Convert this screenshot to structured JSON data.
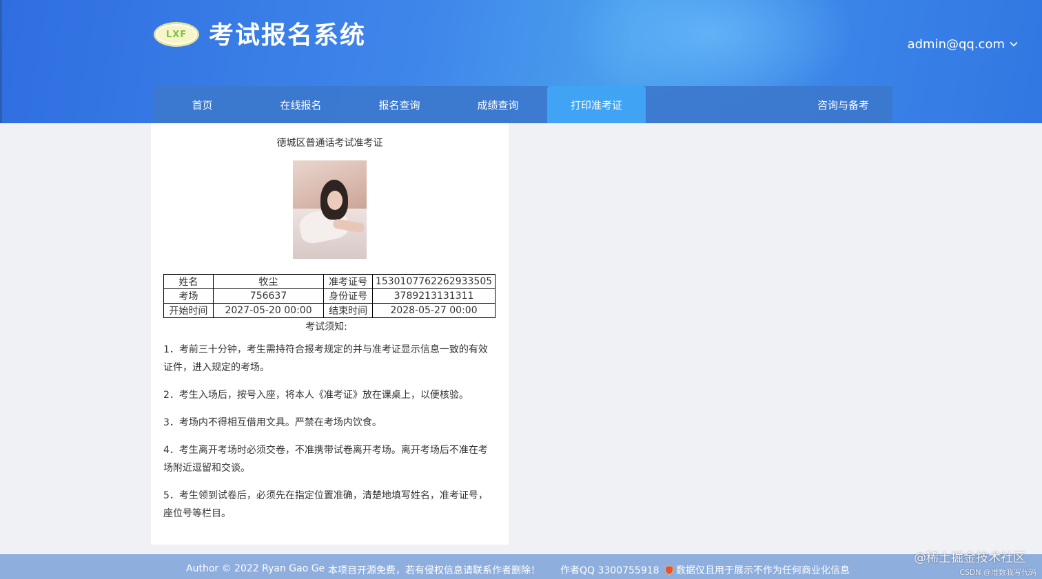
{
  "header": {
    "logo_text": "LXF",
    "site_title": "考试报名系统",
    "user_email": "admin@qq.com"
  },
  "nav": {
    "items": [
      {
        "label": "首页"
      },
      {
        "label": "在线报名"
      },
      {
        "label": "报名查询"
      },
      {
        "label": "成绩查询"
      },
      {
        "label": "打印准考证"
      }
    ],
    "right_item": "咨询与备考",
    "active_index": 4
  },
  "ticket": {
    "title": "德城区普通话考试准考证",
    "rows": [
      {
        "label1": "姓名",
        "value1": "牧尘",
        "label2": "准考证号",
        "value2": "1530107762262933505"
      },
      {
        "label1": "考场",
        "value1": "756637",
        "label2": "身份证号",
        "value2": "3789213131311"
      },
      {
        "label1": "开始时间",
        "value1": "2027-05-20 00:00",
        "label2": "结束时间",
        "value2": "2028-05-27 00:00"
      }
    ],
    "notice_title": "考试须知:",
    "rules": [
      "1．考前三十分钟，考生需持符合报考规定的并与准考证显示信息一致的有效证件，进入规定的考场。",
      "2．考生入场后，按号入座，将本人《准考证》放在课桌上，以便核验。",
      "3．考场内不得相互借用文具。严禁在考场内饮食。",
      "4．考生离开考场时必须交卷，不准携带试卷离开考场。离开考场后不准在考场附近逗留和交谈。",
      "5．考生领到试卷后，必须先在指定位置准确，清楚地填写姓名，准考证号，座位号等栏目。"
    ]
  },
  "footer": {
    "author": "Author © 2022 Ryan Gao Ge",
    "notice": "本项目开源免费，若有侵权信息请联系作者删除！",
    "qq": "作者QQ 3300755918",
    "disclaimer": "数据仅且用于展示不作为任何商业化信息"
  },
  "watermark": {
    "main": "@稀土掘金技术社区",
    "sub": "CSDN @准数我写代码"
  },
  "colors": {
    "header_blue": "#3a84e8",
    "nav_active": "#40a3f4",
    "footer_bg": "#8eaede",
    "page_bg": "#eff1f5"
  },
  "icons": [
    "chevron-down-icon",
    "shield-icon"
  ]
}
